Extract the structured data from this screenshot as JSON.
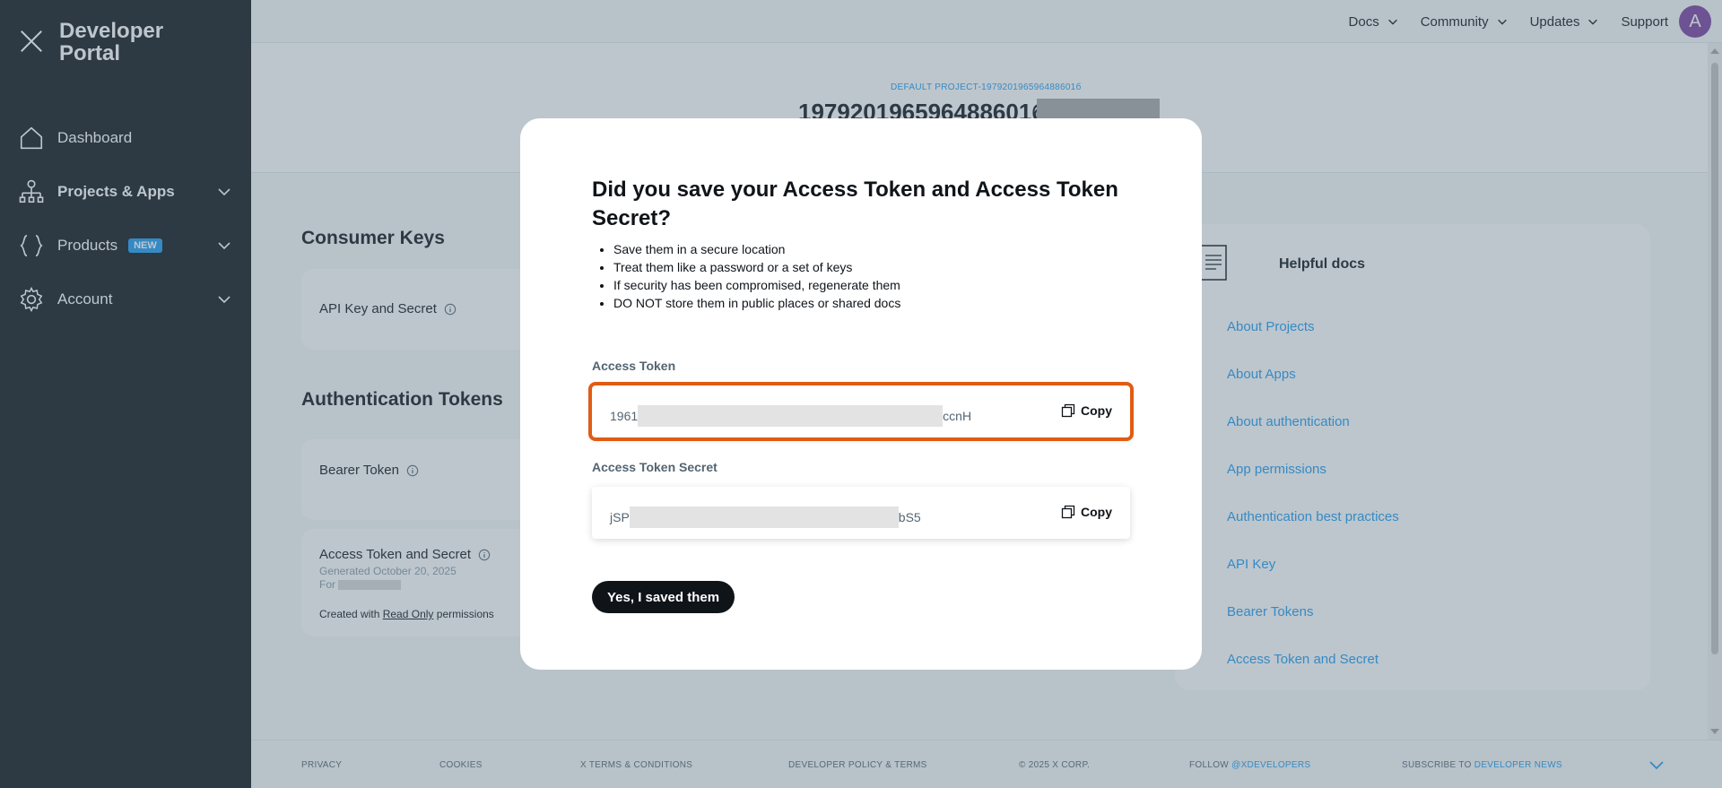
{
  "brand": {
    "title_line1": "Developer",
    "title_line2": "Portal"
  },
  "sidebar": {
    "items": [
      {
        "label": "Dashboard",
        "icon": "home-icon"
      },
      {
        "label": "Projects & Apps",
        "icon": "projects-icon",
        "expandable": true
      },
      {
        "label": "Products",
        "icon": "braces-icon",
        "badge": "NEW",
        "expandable": true
      },
      {
        "label": "Account",
        "icon": "gear-icon",
        "expandable": true
      }
    ]
  },
  "topnav": {
    "docs": "Docs",
    "community": "Community",
    "updates": "Updates",
    "support": "Support",
    "avatar_initial": "A"
  },
  "project": {
    "eyebrow": "DEFAULT PROJECT-197920196596488601б",
    "id": "197920196596488601б"
  },
  "sections": {
    "consumer_keys": "Consumer Keys",
    "api_key_label": "API Key and Secret",
    "auth_tokens": "Authentication Tokens",
    "bearer_label": "Bearer Token",
    "access_label": "Access Token and Secret",
    "generated": "Generated October 20, 2025",
    "for_prefix": "For",
    "created_with": "Created with",
    "read_only": "Read Only",
    "permissions": "permissions"
  },
  "docs": {
    "title": "Helpful docs",
    "links": [
      "About Projects",
      "About Apps",
      "About authentication",
      "App permissions",
      "Authentication best practices",
      "API Key",
      "Bearer Tokens",
      "Access Token and Secret"
    ]
  },
  "footer": {
    "privacy": "PRIVACY",
    "cookies": "COOKIES",
    "terms": "X TERMS & CONDITIONS",
    "policy": "DEVELOPER POLICY & TERMS",
    "copyright": "© 2025 X CORP.",
    "follow_prefix": "FOLLOW",
    "follow_handle": "@XDEVELOPERS",
    "subscribe_prefix": "SUBSCRIBE TO",
    "subscribe_link": "DEVELOPER NEWS"
  },
  "modal": {
    "title": "Did you save your Access Token and Access Token Secret?",
    "bullets": [
      "Save them in a secure location",
      "Treat them like a password or a set of keys",
      "If security has been compromised, regenerate them",
      "DO NOT store them in public places or shared docs"
    ],
    "access_token_label": "Access Token",
    "access_token_start": "1961",
    "access_token_end": "ccnH",
    "access_secret_label": "Access Token Secret",
    "access_secret_start": "jSP",
    "access_secret_end": "bS5",
    "copy_label": "Copy",
    "confirm_label": "Yes, I saved them"
  },
  "colors": {
    "sidebar_bg": "#0f1419",
    "accent": "#1d9bf0",
    "highlight": "#e05c14",
    "avatar": "#7a3ea0"
  }
}
